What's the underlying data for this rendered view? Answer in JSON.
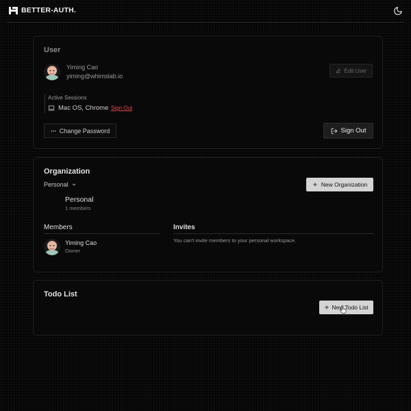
{
  "header": {
    "brand": "BETTER-AUTH."
  },
  "user_card": {
    "title": "User",
    "name": "Yiming Cao",
    "email": "yiming@whimslab.io",
    "edit_label": "Edit User",
    "sessions_label": "Active Sessions",
    "session_device": "Mac OS, Chrome",
    "session_sign_out": "Sign Out",
    "change_password_label": "Change Password",
    "sign_out_label": "Sign Out"
  },
  "org_card": {
    "title": "Organization",
    "selector": "Personal",
    "new_org_label": "New Organization",
    "org_name": "Personal",
    "org_members_count": "1 members",
    "members_title": "Members",
    "invites_title": "Invites",
    "member_name": "Yiming Cao",
    "member_role": "Owner",
    "invites_note": "You can't invite members to your personal workspace."
  },
  "todo_card": {
    "title": "Todo List",
    "new_todo_label": "New Todo List"
  },
  "colors": {
    "accent_red": "#e5484d",
    "button_light": "#d4d4d4",
    "muted": "#8a8a8a"
  }
}
